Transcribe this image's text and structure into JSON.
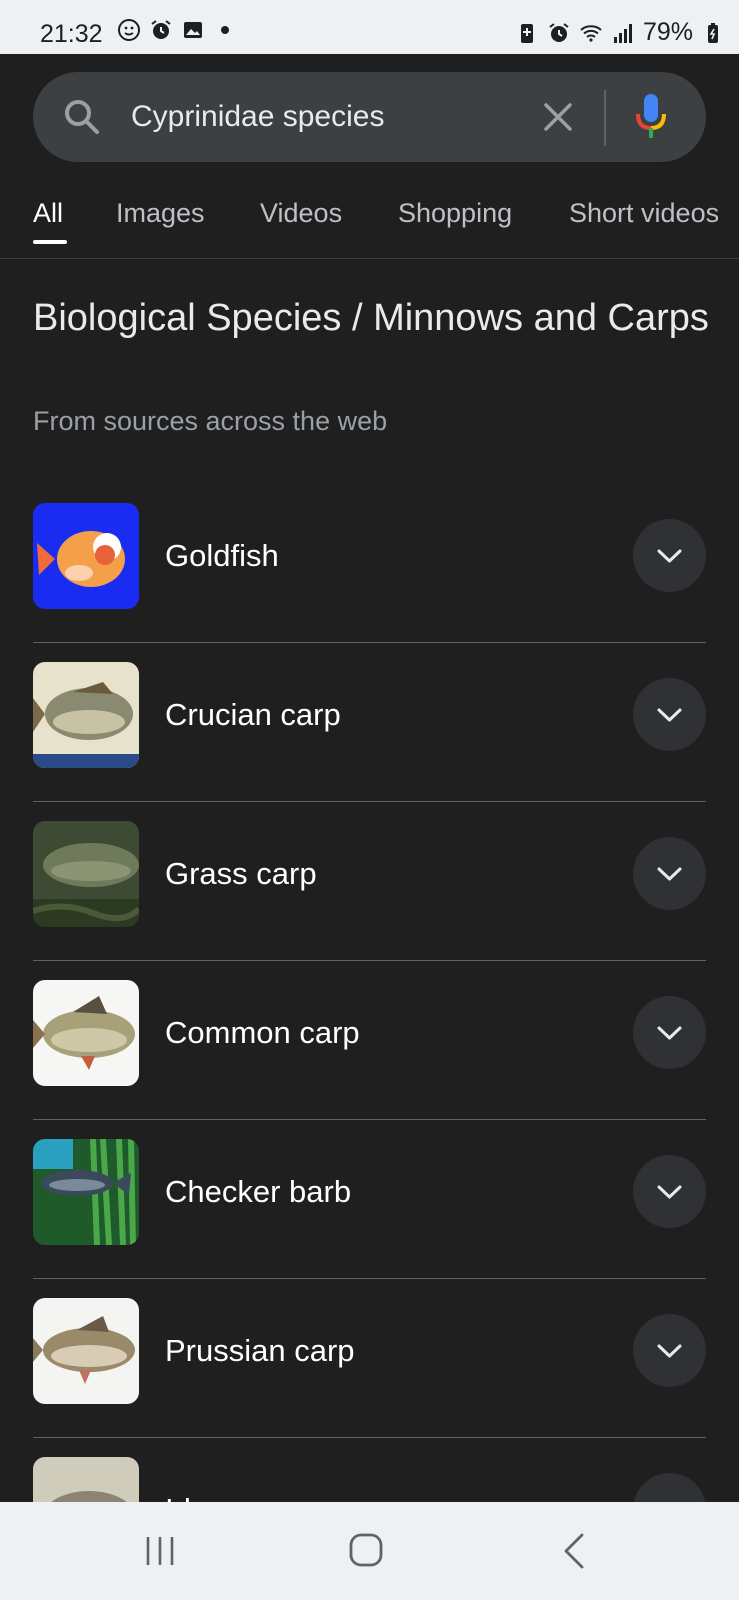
{
  "status_bar": {
    "time": "21:32",
    "battery": "79%",
    "left_icons": [
      "face-icon",
      "alarm-icon",
      "gallery-icon",
      "dot-icon"
    ],
    "right_icons": [
      "battery-saver-icon",
      "alarm-icon",
      "wifi-icon",
      "signal-icon",
      "battery-icon"
    ]
  },
  "search": {
    "query": "Cyprinidae species",
    "icons": [
      "search-icon",
      "clear-icon",
      "mic-icon"
    ]
  },
  "tabs": [
    {
      "label": "All",
      "active": true
    },
    {
      "label": "Images",
      "active": false
    },
    {
      "label": "Videos",
      "active": false
    },
    {
      "label": "Shopping",
      "active": false
    },
    {
      "label": "Short videos",
      "active": false
    }
  ],
  "heading": {
    "title": "Biological Species / Minnows and Carps",
    "subtitle": "From sources across the web"
  },
  "species": [
    {
      "name": "Goldfish"
    },
    {
      "name": "Crucian carp"
    },
    {
      "name": "Grass carp"
    },
    {
      "name": "Common carp"
    },
    {
      "name": "Checker barb"
    },
    {
      "name": "Prussian carp"
    },
    {
      "name": "Ide"
    }
  ],
  "nav": {
    "icons": [
      "recent-apps-icon",
      "home-icon",
      "back-icon"
    ]
  },
  "colors": {
    "background": "#1f1f1f",
    "search_box": "#3c4043",
    "status_bar": "#eef1f3",
    "expand_button": "#303134"
  }
}
